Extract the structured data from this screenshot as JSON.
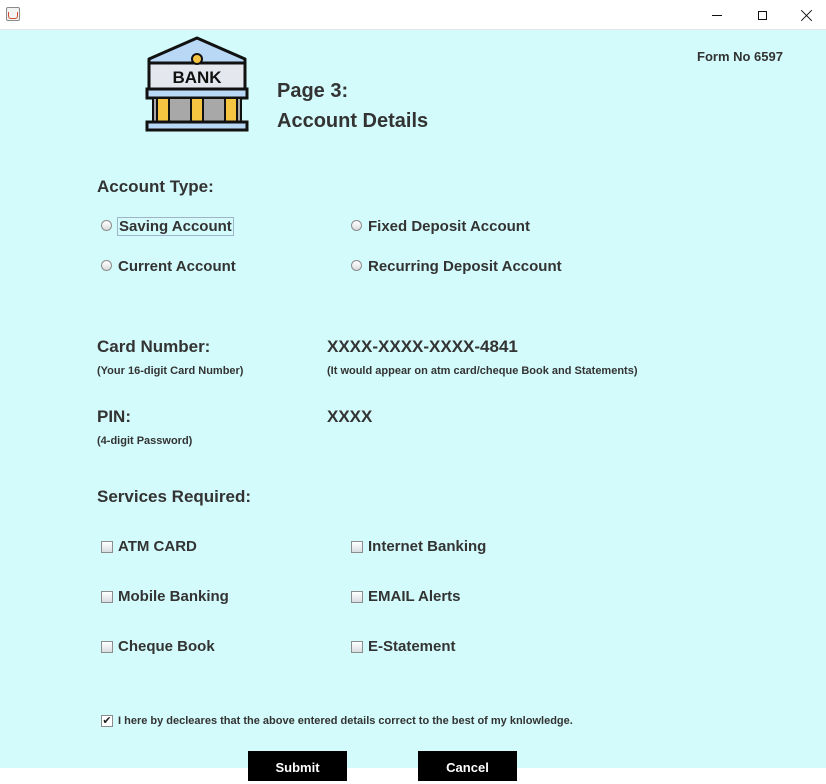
{
  "window": {
    "title": ""
  },
  "header": {
    "logo_text": "BANK",
    "page": "Page 3:",
    "title": "Account Details",
    "form_no": "Form No 6597"
  },
  "account_type": {
    "label": "Account Type:",
    "options": [
      "Saving Account",
      "Fixed Deposit Account",
      "Current Account",
      "Recurring Deposit Account"
    ]
  },
  "card": {
    "label": "Card Number:",
    "hint": "(Your 16-digit Card Number)",
    "value": "XXXX-XXXX-XXXX-4841",
    "value_hint": "(It would appear on atm card/cheque Book and Statements)"
  },
  "pin": {
    "label": "PIN:",
    "hint": "(4-digit Password)",
    "value": "XXXX"
  },
  "services": {
    "label": "Services Required:",
    "options": [
      "ATM CARD",
      "Internet Banking",
      "Mobile Banking",
      "EMAIL Alerts",
      "Cheque Book",
      "E-Statement"
    ]
  },
  "declaration": {
    "checked": true,
    "text": "I here by decleares that the above entered details correct to the best of my knlowledge."
  },
  "buttons": {
    "submit": "Submit",
    "cancel": "Cancel"
  },
  "colors": {
    "background": "#d3fbfb",
    "text": "#333333",
    "button": "#000000"
  }
}
